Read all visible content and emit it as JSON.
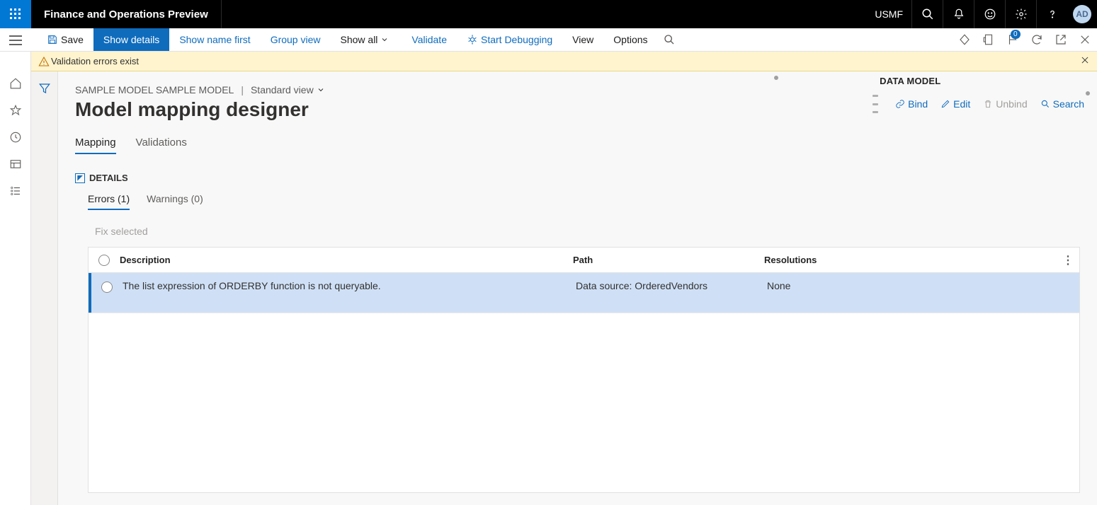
{
  "topbar": {
    "app_title": "Finance and Operations Preview",
    "company": "USMF",
    "avatar": "AD"
  },
  "actionbar": {
    "save": "Save",
    "show_details": "Show details",
    "show_name_first": "Show name first",
    "group_view": "Group view",
    "show_all": "Show all",
    "validate": "Validate",
    "start_debugging": "Start Debugging",
    "view": "View",
    "options": "Options",
    "badge_count": "0"
  },
  "warning_bar": {
    "text": "Validation errors exist"
  },
  "breadcrumb": {
    "context": "SAMPLE MODEL SAMPLE MODEL",
    "view": "Standard view"
  },
  "page": {
    "title": "Model mapping designer"
  },
  "tabs": [
    "Mapping",
    "Validations"
  ],
  "active_tab": 0,
  "data_model": {
    "heading": "DATA MODEL",
    "actions": {
      "bind": "Bind",
      "edit": "Edit",
      "unbind": "Unbind",
      "search": "Search"
    }
  },
  "details": {
    "heading": "DETAILS",
    "sub_tabs": [
      {
        "label": "Errors",
        "count": 1
      },
      {
        "label": "Warnings",
        "count": 0
      }
    ],
    "active_sub_tab": 0,
    "fix_selected": "Fix selected",
    "columns": {
      "description": "Description",
      "path": "Path",
      "resolutions": "Resolutions"
    },
    "rows": [
      {
        "description": "The list expression of ORDERBY function is not queryable.",
        "path": "Data source: OrderedVendors",
        "resolutions": "None"
      }
    ]
  },
  "details_sub_tab_rendered": {
    "errors": "Errors (1)",
    "warnings": "Warnings (0)"
  }
}
